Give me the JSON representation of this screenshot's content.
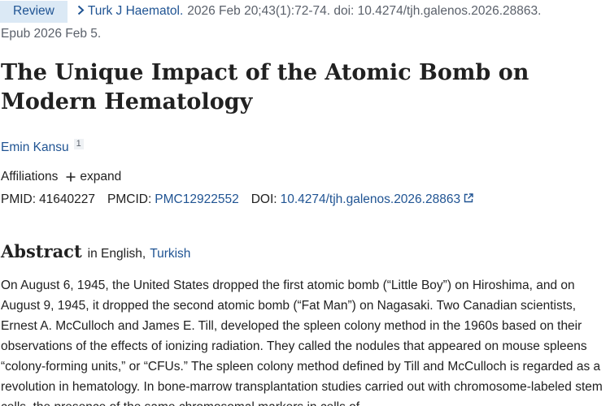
{
  "citation": {
    "badge": "Review",
    "journal": "Turk J Haematol.",
    "details": "2026 Feb 20;43(1):72-74. doi: 10.4274/tjh.galenos.2026.28863.",
    "epub": "Epub 2026 Feb 5."
  },
  "article": {
    "title": "The Unique Impact of the Atomic Bomb on Modern Hematology"
  },
  "authors": {
    "name": "Emin Kansu",
    "affiliation_ref": "1"
  },
  "affiliations": {
    "label": "Affiliations",
    "expand_label": "expand"
  },
  "identifiers": {
    "pmid_label": "PMID:",
    "pmid": "41640227",
    "pmcid_label": "PMCID:",
    "pmcid": "PMC12922552",
    "doi_label": "DOI:",
    "doi": "10.4274/tjh.galenos.2026.28863"
  },
  "abstract": {
    "heading": "Abstract",
    "lang_prefix": "in English,",
    "alt_language": "Turkish",
    "text": "On August 6, 1945, the United States dropped the first atomic bomb (“Little Boy”) on Hiroshima, and on August 9, 1945, it dropped the second atomic bomb (“Fat Man”) on Nagasaki. Two Canadian scientists, Ernest A. McCulloch and James E. Till, developed the spleen colony method in the 1960s based on their observations of the effects of ionizing radiation. They called the nodules that appeared on mouse spleens “colony-forming units,” or “CFUs.” The spleen colony method defined by Till and McCulloch is regarded as a revolution in hematology. In bone-marrow transplantation studies carried out with chromosome-labeled stem cells, the presence of the same chromosomal markers in cells of"
  },
  "colors": {
    "link": "#205493",
    "badge_bg": "#dbe9f5",
    "text": "#212121",
    "muted": "#5b616b"
  },
  "icons": {
    "breadcrumb": "chevron-right-icon",
    "expand": "plus-icon",
    "doi_external": "external-link-icon"
  }
}
